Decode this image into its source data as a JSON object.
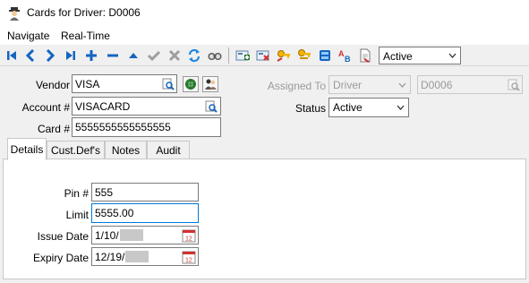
{
  "window": {
    "title": "Cards for Driver: D0006",
    "icon": "driver-icon"
  },
  "menu": {
    "items": [
      "Navigate",
      "Real-Time"
    ]
  },
  "toolbar": {
    "status_filter": "Active",
    "icons": [
      "first-icon",
      "previous-icon",
      "next-icon",
      "last-icon",
      "add-icon",
      "delete-icon",
      "up-icon",
      "confirm-icon",
      "cancel-icon",
      "refresh-icon",
      "search-icon",
      "new-card-icon",
      "remove-card-icon",
      "key-icon",
      "keys-icon",
      "card-stack-icon",
      "alpha-sort-icon",
      "export-icon"
    ]
  },
  "form": {
    "vendor_label": "Vendor",
    "vendor_value": "VISA",
    "account_label": "Account #",
    "account_value": "VISACARD",
    "card_label": "Card #",
    "card_value": "5555555555555555",
    "assigned_label": "Assigned To",
    "assigned_value": "Driver",
    "assigned_id": "D0006",
    "status_label": "Status",
    "status_value": "Active"
  },
  "tabs": [
    "Details",
    "Cust.Def's",
    "Notes",
    "Audit"
  ],
  "details": {
    "pin_label": "Pin #",
    "pin_value": "555",
    "limit_label": "Limit",
    "limit_value": "5555.00",
    "issue_label": "Issue Date",
    "issue_value": "1/10/",
    "expiry_label": "Expiry Date",
    "expiry_value": "12/19/"
  }
}
